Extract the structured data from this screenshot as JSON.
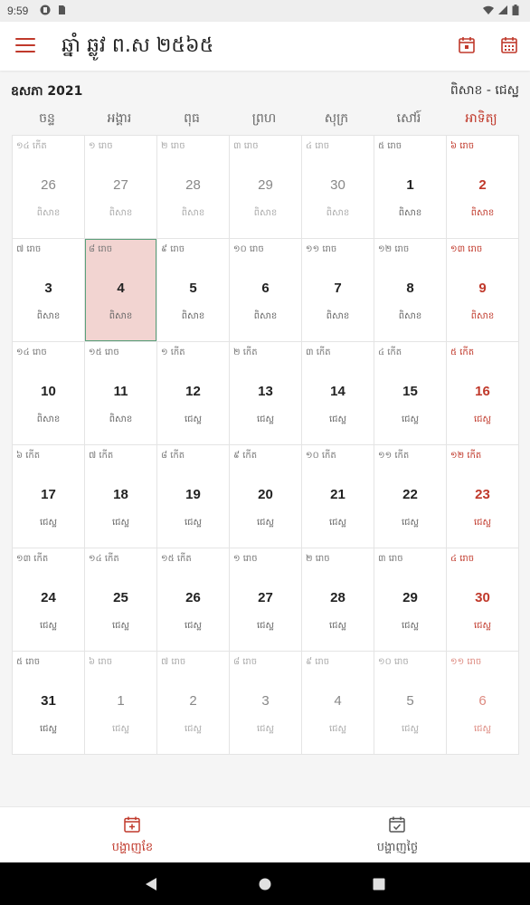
{
  "status_bar": {
    "time": "9:59"
  },
  "app_bar": {
    "title": "ឆ្នាំ ឆ្លូវ ព.ស ២៥៦៥"
  },
  "calendar": {
    "month_label": "ឧសភា 2021",
    "lunar_range": "ពិសាខ - ជេស្ឋ",
    "weekdays": [
      "ចន្ទ",
      "អង្គារ",
      "ពុធ",
      "ព្រហ",
      "សុក្រ",
      "សៅរ៍",
      "អាទិត្យ"
    ],
    "days": [
      {
        "day": "26",
        "lunar": "១៤ កើត",
        "month": "ពិសាខ",
        "current": false,
        "today": false
      },
      {
        "day": "27",
        "lunar": "១ រោច",
        "month": "ពិសាខ",
        "current": false,
        "today": false
      },
      {
        "day": "28",
        "lunar": "២ រោច",
        "month": "ពិសាខ",
        "current": false,
        "today": false
      },
      {
        "day": "29",
        "lunar": "៣ រោច",
        "month": "ពិសាខ",
        "current": false,
        "today": false
      },
      {
        "day": "30",
        "lunar": "៤ រោច",
        "month": "ពិសាខ",
        "current": false,
        "today": false
      },
      {
        "day": "1",
        "lunar": "៥ រោច",
        "month": "ពិសាខ",
        "current": true,
        "today": false
      },
      {
        "day": "2",
        "lunar": "៦ រោច",
        "month": "ពិសាខ",
        "current": true,
        "today": false
      },
      {
        "day": "3",
        "lunar": "៧ រោច",
        "month": "ពិសាខ",
        "current": true,
        "today": false
      },
      {
        "day": "4",
        "lunar": "៨ រោច",
        "month": "ពិសាខ",
        "current": true,
        "today": true
      },
      {
        "day": "5",
        "lunar": "៩ រោច",
        "month": "ពិសាខ",
        "current": true,
        "today": false
      },
      {
        "day": "6",
        "lunar": "១០ រោច",
        "month": "ពិសាខ",
        "current": true,
        "today": false
      },
      {
        "day": "7",
        "lunar": "១១ រោច",
        "month": "ពិសាខ",
        "current": true,
        "today": false
      },
      {
        "day": "8",
        "lunar": "១២ រោច",
        "month": "ពិសាខ",
        "current": true,
        "today": false
      },
      {
        "day": "9",
        "lunar": "១៣ រោច",
        "month": "ពិសាខ",
        "current": true,
        "today": false
      },
      {
        "day": "10",
        "lunar": "១៤ រោច",
        "month": "ពិសាខ",
        "current": true,
        "today": false
      },
      {
        "day": "11",
        "lunar": "១៥ រោច",
        "month": "ពិសាខ",
        "current": true,
        "today": false
      },
      {
        "day": "12",
        "lunar": "១ កើត",
        "month": "ជេស្ឋ",
        "current": true,
        "today": false
      },
      {
        "day": "13",
        "lunar": "២ កើត",
        "month": "ជេស្ឋ",
        "current": true,
        "today": false
      },
      {
        "day": "14",
        "lunar": "៣ កើត",
        "month": "ជេស្ឋ",
        "current": true,
        "today": false
      },
      {
        "day": "15",
        "lunar": "៤ កើត",
        "month": "ជេស្ឋ",
        "current": true,
        "today": false
      },
      {
        "day": "16",
        "lunar": "៥ កើត",
        "month": "ជេស្ឋ",
        "current": true,
        "today": false
      },
      {
        "day": "17",
        "lunar": "៦ កើត",
        "month": "ជេស្ឋ",
        "current": true,
        "today": false
      },
      {
        "day": "18",
        "lunar": "៧ កើត",
        "month": "ជេស្ឋ",
        "current": true,
        "today": false
      },
      {
        "day": "19",
        "lunar": "៨ កើត",
        "month": "ជេស្ឋ",
        "current": true,
        "today": false
      },
      {
        "day": "20",
        "lunar": "៩ កើត",
        "month": "ជេស្ឋ",
        "current": true,
        "today": false
      },
      {
        "day": "21",
        "lunar": "១០ កើត",
        "month": "ជេស្ឋ",
        "current": true,
        "today": false
      },
      {
        "day": "22",
        "lunar": "១១ កើត",
        "month": "ជេស្ឋ",
        "current": true,
        "today": false
      },
      {
        "day": "23",
        "lunar": "១២ កើត",
        "month": "ជេស្ឋ",
        "current": true,
        "today": false
      },
      {
        "day": "24",
        "lunar": "១៣ កើត",
        "month": "ជេស្ឋ",
        "current": true,
        "today": false
      },
      {
        "day": "25",
        "lunar": "១៤ កើត",
        "month": "ជេស្ឋ",
        "current": true,
        "today": false
      },
      {
        "day": "26",
        "lunar": "១៥ កើត",
        "month": "ជេស្ឋ",
        "current": true,
        "today": false
      },
      {
        "day": "27",
        "lunar": "១ រោច",
        "month": "ជេស្ឋ",
        "current": true,
        "today": false
      },
      {
        "day": "28",
        "lunar": "២ រោច",
        "month": "ជេស្ឋ",
        "current": true,
        "today": false
      },
      {
        "day": "29",
        "lunar": "៣ រោច",
        "month": "ជេស្ឋ",
        "current": true,
        "today": false
      },
      {
        "day": "30",
        "lunar": "៤ រោច",
        "month": "ជេស្ឋ",
        "current": true,
        "today": false
      },
      {
        "day": "31",
        "lunar": "៥ រោច",
        "month": "ជេស្ឋ",
        "current": true,
        "today": false
      },
      {
        "day": "1",
        "lunar": "៦ រោច",
        "month": "ជេស្ឋ",
        "current": false,
        "today": false
      },
      {
        "day": "2",
        "lunar": "៧ រោច",
        "month": "ជេស្ឋ",
        "current": false,
        "today": false
      },
      {
        "day": "3",
        "lunar": "៨ រោច",
        "month": "ជេស្ឋ",
        "current": false,
        "today": false
      },
      {
        "day": "4",
        "lunar": "៩ រោច",
        "month": "ជេស្ឋ",
        "current": false,
        "today": false
      },
      {
        "day": "5",
        "lunar": "១០ រោច",
        "month": "ជេស្ឋ",
        "current": false,
        "today": false
      },
      {
        "day": "6",
        "lunar": "១១ រោច",
        "month": "ជេស្ឋ",
        "current": false,
        "today": false
      }
    ]
  },
  "bottom_nav": {
    "items": [
      {
        "label": "បង្ហាញខែ",
        "icon": "calendar-plus-icon",
        "active": true
      },
      {
        "label": "បង្ហាញថ្ងៃ",
        "icon": "calendar-check-icon",
        "active": false
      }
    ]
  },
  "colors": {
    "accent": "#c0392b",
    "today_bg": "#f2d4d1",
    "today_border": "#5aa07a"
  }
}
